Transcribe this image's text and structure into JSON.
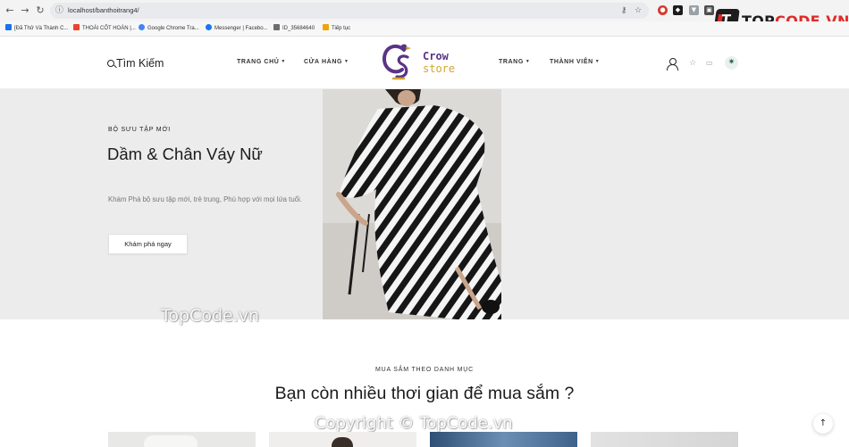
{
  "browser": {
    "url": "localhost/banthoitrang4/",
    "bookmarks": [
      {
        "label": "[Đã Thử Và Thành C...",
        "color": "#1a73e8"
      },
      {
        "label": "THOÁI CỐT HOÀN |...",
        "color": "#e8452c"
      },
      {
        "label": "Google Chrome Tra...",
        "color": "#4285f4"
      },
      {
        "label": "Messenger | Facebo...",
        "color": "#1877f2"
      },
      {
        "label": "ID_35684640",
        "color": "#6e6e6e"
      },
      {
        "label": "Tiếp tục",
        "color": "#f0a30a"
      }
    ]
  },
  "watermark_logo": {
    "prefix": "T",
    "text_a": "TOP",
    "text_b": "CODE.VN"
  },
  "watermarks": {
    "mid": "TopCode.vn",
    "bottom": "Copyright © TopCode.vn"
  },
  "header": {
    "search_label": "Tìm Kiếm",
    "nav": [
      "TRANG CHỦ",
      "CỬA HÀNG",
      "TRANG",
      "THÀNH VIÊN"
    ],
    "logo_line1": "Crow",
    "logo_line2": "store",
    "logo_mark": "CS"
  },
  "hero": {
    "eyebrow": "BỘ SƯU TẬP MỚI",
    "title": "Dầm & Chân Váy Nữ",
    "description": "Khám Phá bộ sưu tập mới, trẻ trung, Phù hợp với mọi lứa tuổi.",
    "cta": "Khám phá ngay"
  },
  "section": {
    "eyebrow": "MUA SẮM THEO DANH MỤC",
    "title": "Bạn còn nhiều thơi gian để mua sắm ?"
  },
  "colors": {
    "brand_purple": "#5a3486",
    "brand_gold": "#d4a632",
    "hero_bg": "#ececec"
  }
}
